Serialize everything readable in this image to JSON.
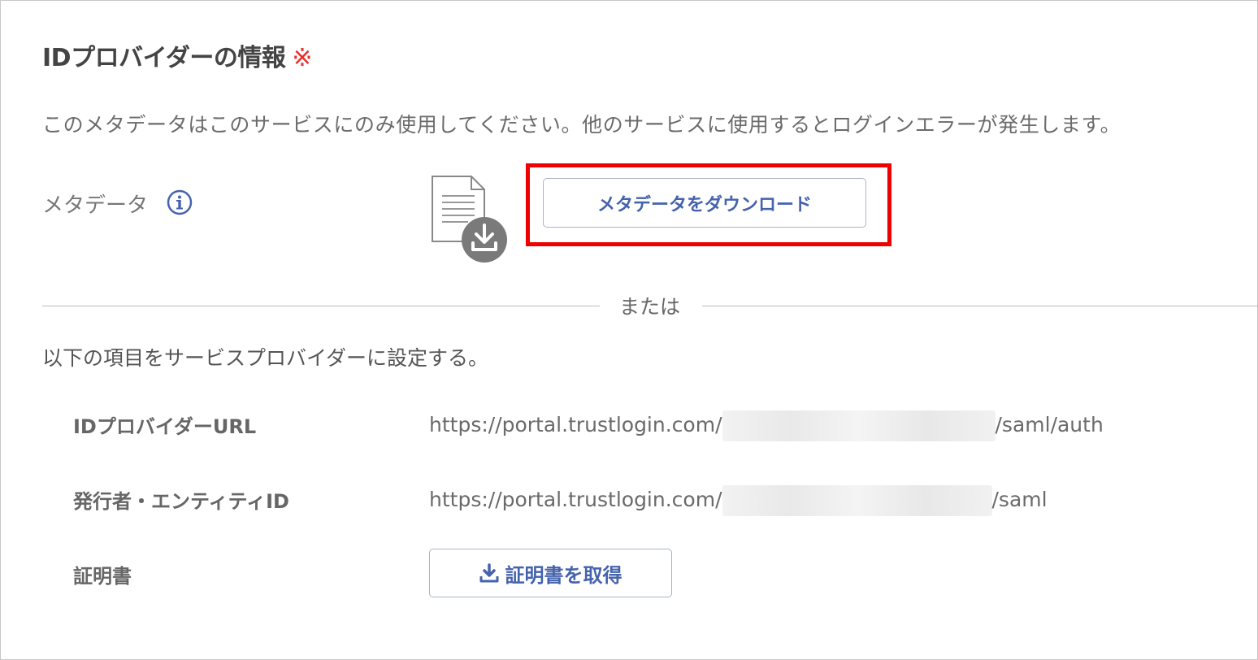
{
  "section": {
    "title": "IDプロバイダーの情報",
    "required_mark": "※",
    "notice": "このメタデータはこのサービスにのみ使用してください。他のサービスに使用するとログインエラーが発生します。"
  },
  "metadata": {
    "label": "メタデータ",
    "download_button": "メタデータをダウンロード"
  },
  "separator": {
    "text": "または"
  },
  "instruction": "以下の項目をサービスプロバイダーに設定する。",
  "fields": {
    "idp_url": {
      "label": "IDプロバイダーURL",
      "prefix": "https://portal.trustlogin.com/",
      "suffix": "/saml/auth"
    },
    "entity_id": {
      "label": "発行者・エンティティID",
      "prefix": "https://portal.trustlogin.com/",
      "suffix": "/saml"
    },
    "certificate": {
      "label": "証明書",
      "button": "証明書を取得"
    }
  },
  "colors": {
    "accent": "#4563ad",
    "required": "#e8302e",
    "highlight": "#ee0000"
  },
  "icons": [
    "info-icon",
    "metadata-file-download-icon",
    "download-icon"
  ]
}
